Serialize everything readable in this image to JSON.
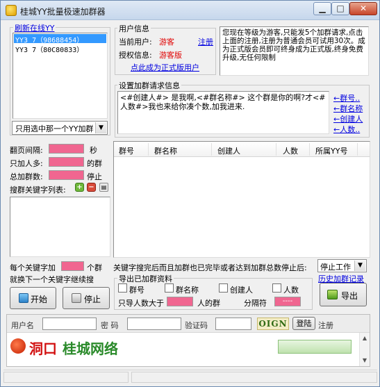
{
  "window": {
    "title": "桂城YY批量极速加群器"
  },
  "window_buttons": {
    "minimize": "▁",
    "maximize": "□",
    "close": "✕"
  },
  "left_top": {
    "refresh_link": "刷新在线YY",
    "yy_list": [
      "YY3 7（98688454）",
      "YY3 7（80C80833）"
    ],
    "mode_select": "只用选中那一个YY加群"
  },
  "user_info": {
    "legend": "用户信息",
    "current_user_label": "当前用户:",
    "current_user_value": "游客",
    "register_link": "注册",
    "auth_label": "授权信息:",
    "auth_value": "游客版",
    "upgrade_link": "点此成为正式版用户",
    "notice": "您现在等级为游客,只能发5个加群请求,点击上面的注册,注册为普通会员可试用30次。成为正式版会员即可终身成为正式版,终身免费升级,无任何限制"
  },
  "request": {
    "legend": "设置加群请求信息",
    "text": "<#创建人#> 是我啊,<#群名称#> 这个群是你的啊?才<#人数#>我也来给你凑个数,加我进来.",
    "links": [
      "←群号..",
      "←群名称",
      "←创建人",
      "←人数.."
    ]
  },
  "settings": {
    "page_interval_label": "翻页间隔:",
    "page_interval_unit": "秒",
    "only_join_label": "只加人多:",
    "only_join_unit": "的群",
    "total_join_label": "总加群数:",
    "total_join_unit": "停止",
    "keyword_label": "搜群关键字列表:"
  },
  "table": {
    "columns": [
      "群号",
      "群名称",
      "创建人",
      "人数",
      "所属YY号"
    ]
  },
  "bottom": {
    "per_keyword_pre": "每个关键字加",
    "per_keyword_post": "个群",
    "next_keyword": "就换下一个关键字继续搜",
    "finish_text": "关键字搜完后而且加群也已完毕或者达到加群总数停止后:",
    "finish_action": "停止工作",
    "history_link": "历史加群记录",
    "export_legend": "导出已加群资料",
    "export_checks": [
      "群号",
      "群名称",
      "创建人",
      "人数"
    ],
    "export_only_pre": "只导人数大于",
    "export_only_post": "人的群",
    "separator_label": "分隔符",
    "separator_value": "----",
    "start_button": "开始",
    "stop_button": "停止",
    "export_button": "导出"
  },
  "login": {
    "username_label": "用户名",
    "password_label": "密 码",
    "captcha_label": "验证码",
    "captcha_image": "OIGN",
    "login_button": "登陆",
    "register_link": "注册"
  },
  "banner": {
    "brand": "桂城网络",
    "logo_text": "洞口"
  },
  "colors": {
    "accent_red": "#e00000",
    "link_blue": "#0000e0",
    "pink_field": "#f06690"
  },
  "icons": [
    "app-icon",
    "plus-icon",
    "minus-icon",
    "clear-icon",
    "start-icon",
    "stop-icon",
    "export-icon"
  ]
}
